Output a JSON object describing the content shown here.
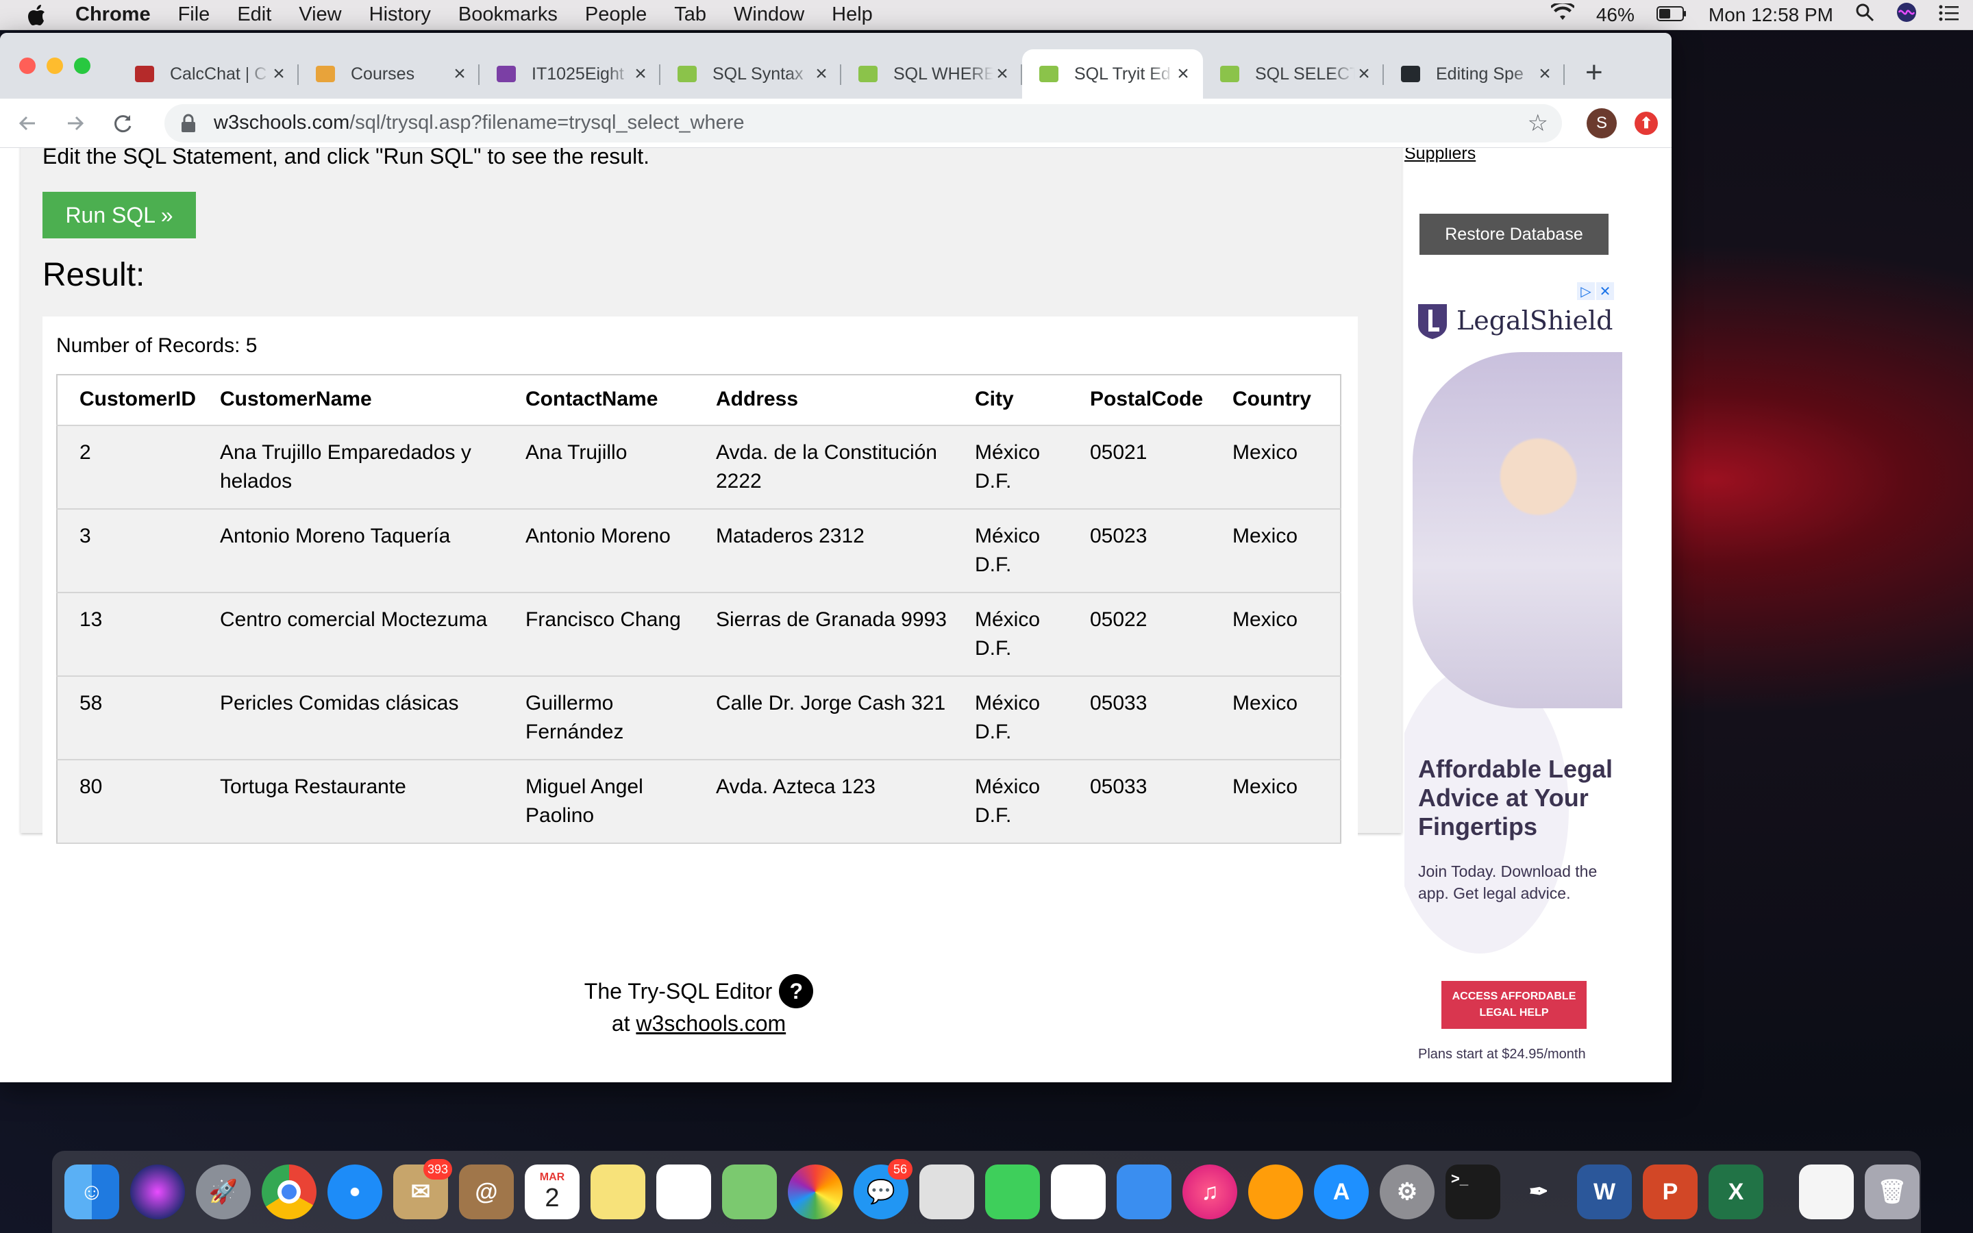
{
  "menubar": {
    "app": "Chrome",
    "items": [
      "File",
      "Edit",
      "View",
      "History",
      "Bookmarks",
      "People",
      "Tab",
      "Window",
      "Help"
    ],
    "battery": "46%",
    "clock": "Mon 12:58 PM"
  },
  "tabs": [
    {
      "title": "CalcChat | C",
      "icon": "calcchat-icon",
      "color": "#b52a2a"
    },
    {
      "title": "Courses",
      "icon": "courses-icon",
      "color": "#e8a33a"
    },
    {
      "title": "IT1025Eight",
      "icon": "onenote-icon",
      "color": "#7b3fa5"
    },
    {
      "title": "SQL Syntax",
      "icon": "w3schools-icon",
      "color": "#8bc34a"
    },
    {
      "title": "SQL WHERE",
      "icon": "w3schools-icon",
      "color": "#8bc34a"
    },
    {
      "title": "SQL Tryit Ed",
      "icon": "w3schools-icon",
      "color": "#8bc34a",
      "active": true
    },
    {
      "title": "SQL SELECT",
      "icon": "w3schools-icon",
      "color": "#8bc34a"
    },
    {
      "title": "Editing Spe",
      "icon": "github-icon",
      "color": "#24292e"
    }
  ],
  "address": {
    "host": "w3schools.com",
    "path": "/sql/trysql.asp?filename=trysql_select_where"
  },
  "profile_initial": "S",
  "page": {
    "instruction": "Edit the SQL Statement, and click \"Run SQL\" to see the result.",
    "run_button": "Run SQL »",
    "result_heading": "Result:",
    "records": "Number of Records: 5",
    "sidebar_link": "Suppliers",
    "restore_button": "Restore Database"
  },
  "table": {
    "columns": [
      "CustomerID",
      "CustomerName",
      "ContactName",
      "Address",
      "City",
      "PostalCode",
      "Country"
    ],
    "rows": [
      [
        "2",
        "Ana Trujillo Emparedados y helados",
        "Ana Trujillo",
        "Avda. de la Constitución 2222",
        "México D.F.",
        "05021",
        "Mexico"
      ],
      [
        "3",
        "Antonio Moreno Taquería",
        "Antonio Moreno",
        "Mataderos 2312",
        "México D.F.",
        "05023",
        "Mexico"
      ],
      [
        "13",
        "Centro comercial Moctezuma",
        "Francisco Chang",
        "Sierras de Granada 9993",
        "México D.F.",
        "05022",
        "Mexico"
      ],
      [
        "58",
        "Pericles Comidas clásicas",
        "Guillermo Fernández",
        "Calle Dr. Jorge Cash 321",
        "México D.F.",
        "05033",
        "Mexico"
      ],
      [
        "80",
        "Tortuga Restaurante",
        "Miguel Angel Paolino",
        "Avda. Azteca 123",
        "México D.F.",
        "05033",
        "Mexico"
      ]
    ]
  },
  "footer": {
    "line1": "The Try-SQL Editor",
    "at": "at",
    "link": "w3schools.com"
  },
  "ad": {
    "brand": "LegalShield",
    "headline": "Affordable Legal Advice at Your Fingertips",
    "sub": "Join Today. Download the app. Get legal advice.",
    "cta": "ACCESS AFFORDABLE LEGAL HELP",
    "plans": "Plans start at $24.95/month"
  },
  "dock": {
    "badges": {
      "mail": "393",
      "messages": "56"
    },
    "calendar_month": "MAR",
    "calendar_day": "2"
  }
}
